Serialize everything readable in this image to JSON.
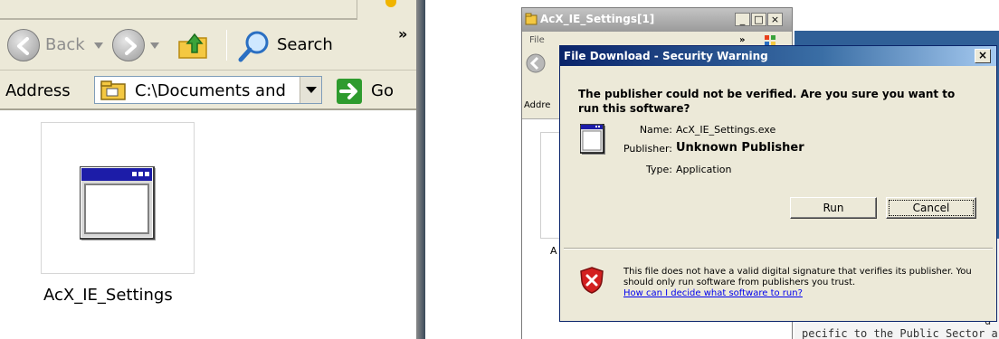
{
  "left": {
    "toolbar": {
      "back_label": "Back",
      "search_label": "Search",
      "chevron": "»"
    },
    "address": {
      "label": "Address",
      "path": "C:\\Documents and Settings",
      "go_label": "Go"
    },
    "file": {
      "name": "AcX_IE_Settings"
    }
  },
  "right": {
    "bg_window": {
      "title": "AcX_IE_Settings[1]",
      "menu_file": "File",
      "menu_chevron": "»",
      "address_fragment": "Addre",
      "content_fragment": "A",
      "minimize": "_",
      "maximize": "□",
      "close": "×"
    },
    "bg_page_fragments": {
      "line1": "d",
      "line2": "pecific to the Public Sector area"
    },
    "dialog": {
      "title": "File Download - Security Warning",
      "close": "×",
      "question": "The publisher could not be verified.  Are you sure you want to run this software?",
      "fields": [
        {
          "label": "Name:",
          "value": "AcX_IE_Settings.exe",
          "bold": false
        },
        {
          "label": "Publisher:",
          "value": "Unknown Publisher",
          "bold": true
        },
        {
          "label": "Type:",
          "value": "Application",
          "bold": false
        }
      ],
      "run_label": "Run",
      "cancel_label": "Cancel",
      "warning": "This file does not have a valid digital signature that verifies its publisher.  You should only run software from publishers you trust.",
      "link": "How can I decide what software to run?"
    }
  },
  "colors": {
    "chrome": "#ece9d8",
    "dialog_title_start": "#0a246a",
    "dialog_title_end": "#a6caf0",
    "link": "#0000ee",
    "shield_red": "#d32020",
    "bg_blue": "#2f5f97"
  },
  "icons": [
    "back-arrow-icon",
    "forward-arrow-icon",
    "folder-up-icon",
    "search-magnifier-icon",
    "address-folder-icon",
    "go-arrow-icon",
    "application-window-icon",
    "security-shield-icon"
  ]
}
